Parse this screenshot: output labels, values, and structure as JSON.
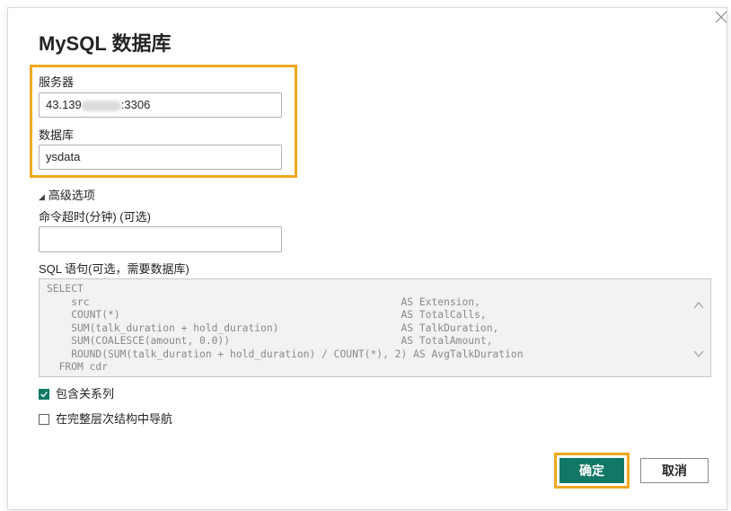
{
  "dialog": {
    "title": "MySQL 数据库",
    "server_label": "服务器",
    "server_value_prefix": "43.139",
    "server_value_suffix": ":3306",
    "database_label": "数据库",
    "database_value": "ysdata",
    "advanced_toggle": "高级选项",
    "timeout_label": "命令超时(分钟) (可选)",
    "timeout_value": "",
    "sql_label": "SQL 语句(可选，需要数据库)",
    "sql_text": "SELECT\n    src                                                   AS Extension,\n    COUNT(*)                                              AS TotalCalls,\n    SUM(talk_duration + hold_duration)                    AS TalkDuration,\n    SUM(COALESCE(amount, 0.0))                            AS TotalAmount,\n    ROUND(SUM(talk_duration + hold_duration) / COUNT(*), 2) AS AvgTalkDuration\n  FROM cdr",
    "include_relations_label": "包含关系列",
    "include_relations_checked": true,
    "navigate_hierarchy_label": "在完整层次结构中导航",
    "navigate_hierarchy_checked": false,
    "ok_label": "确定",
    "cancel_label": "取消"
  },
  "colors": {
    "accent": "#117865",
    "highlight": "#f0a81e"
  },
  "icons": {
    "close": "close-icon",
    "collapse": "triangle-down-icon",
    "scroll_up": "chevron-up-icon",
    "scroll_down": "chevron-down-icon",
    "check": "check-icon"
  }
}
